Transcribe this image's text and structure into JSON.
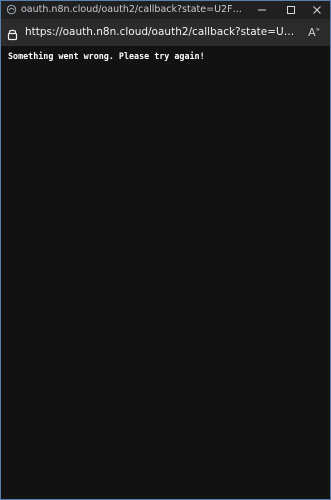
{
  "window": {
    "title": "oauth.n8n.cloud/oauth2/callback?state=U2FsdGVkX18Wn0rO...",
    "controls": {
      "minimize": "minimize-icon",
      "maximize": "maximize-icon",
      "close": "close-icon"
    }
  },
  "address_bar": {
    "url": "https://oauth.n8n.cloud/oauth2/callback?state=U2FsdGVkX18Wn0r...",
    "lock_icon": "lock-icon",
    "read_aloud_icon": "read-aloud-icon"
  },
  "page": {
    "message": "Something went wrong. Please try again!"
  },
  "colors": {
    "titlebar": "#202020",
    "addressbar": "#2b2b2b",
    "content_bg": "#121212",
    "border": "#5a7fae"
  }
}
